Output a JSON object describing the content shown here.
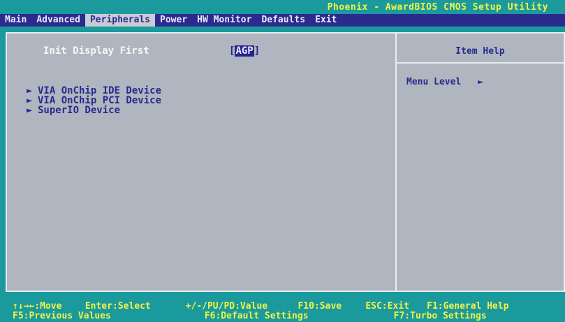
{
  "title": "Phoenix - AwardBIOS CMOS Setup Utility",
  "menu": {
    "items": [
      {
        "label": "Main"
      },
      {
        "label": "Advanced"
      },
      {
        "label": "Peripherals"
      },
      {
        "label": "Power"
      },
      {
        "label": "HW Monitor"
      },
      {
        "label": "Defaults"
      },
      {
        "label": "Exit"
      }
    ],
    "active": "Peripherals"
  },
  "setting": {
    "label": "Init Display First",
    "value_open": "[",
    "value": "AGP",
    "value_close": "]"
  },
  "submenus": [
    {
      "arrow": "►",
      "label": "VIA OnChip IDE Device"
    },
    {
      "arrow": "►",
      "label": "VIA OnChip PCI Device"
    },
    {
      "arrow": "►",
      "label": "SuperIO Device"
    }
  ],
  "help": {
    "title": "Item Help",
    "menu_level_label": "Menu Level",
    "menu_level_arrow": "►"
  },
  "footer": {
    "row1": [
      {
        "text": "↑↓→←:Move"
      },
      {
        "text": "Enter:Select"
      },
      {
        "text": "+/-/PU/PD:Value"
      },
      {
        "text": "F10:Save"
      },
      {
        "text": "ESC:Exit"
      },
      {
        "text": "F1:General Help"
      }
    ],
    "row2": [
      {
        "text": "F5:Previous Values"
      },
      {
        "text": "F6:Default Settings"
      },
      {
        "text": "F7:Turbo Settings"
      }
    ]
  },
  "colors": {
    "background": "#1a9a9c",
    "menu_bar": "#2b2b8e",
    "panel": "#b0b6bf",
    "title_text": "#f2f24a"
  }
}
